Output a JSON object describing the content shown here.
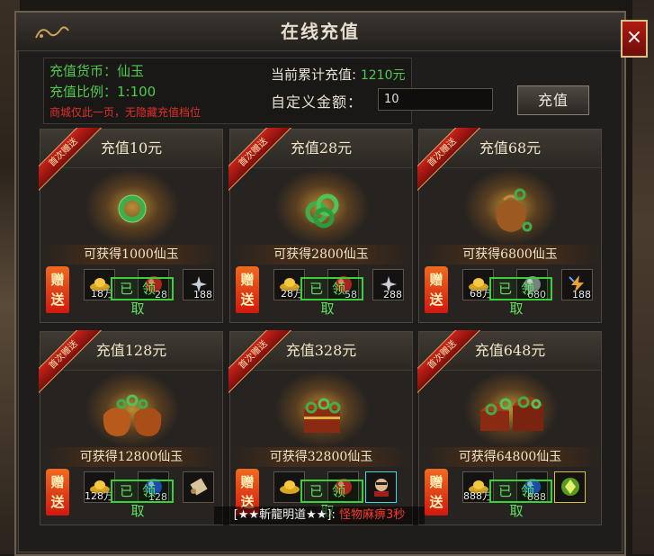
{
  "window": {
    "title": "在线充值",
    "close_label": "×"
  },
  "info": {
    "currency": "充值货币：仙玉",
    "ratio": "充值比例：1:100",
    "warning": "商城仅此一页，无隐藏充值档位"
  },
  "total": {
    "label": "当前累计充值:",
    "value": "1210元"
  },
  "custom_amount": {
    "label": "自定义金额：",
    "value": "10"
  },
  "pay_button": "充值",
  "cards": [
    {
      "ribbon": "首次赠送",
      "title": "充值10元",
      "gain": "可获得1000仙玉",
      "gift": "赠送",
      "slot1": "18万",
      "slot2": "28",
      "slot3": "188",
      "claimed": "已领取",
      "art": "jade-ring"
    },
    {
      "ribbon": "首次赠送",
      "title": "充值28元",
      "gain": "可获得2800仙玉",
      "gift": "赠送",
      "slot1": "28万",
      "slot2": "58",
      "slot3": "288",
      "claimed": "已领取",
      "art": "jade-rings"
    },
    {
      "ribbon": "首次赠送",
      "title": "充值68元",
      "gain": "可获得6800仙玉",
      "gift": "赠送",
      "slot1": "68万",
      "slot2": "680",
      "slot3": "188",
      "claimed": "已领取",
      "art": "jade-bag"
    },
    {
      "ribbon": "首次赠送",
      "title": "充值128元",
      "gain": "可获得12800仙玉",
      "gift": "赠送",
      "slot1": "128万",
      "slot2": "128",
      "slot3": "",
      "claimed": "已领取",
      "art": "jade-bags"
    },
    {
      "ribbon": "首次赠送",
      "title": "充值328元",
      "gain": "可获得32800仙玉",
      "gift": "赠送",
      "slot1": "",
      "slot2": "",
      "slot3": "",
      "claimed": "已领取",
      "art": "treasure-chest"
    },
    {
      "ribbon": "首次赠送",
      "title": "充值648元",
      "gain": "可获得64800仙玉",
      "gift": "赠送",
      "slot1": "888万",
      "slot2": "888",
      "slot3": "",
      "claimed": "已领取",
      "art": "treasure-chests"
    }
  ],
  "notice": {
    "prefix": "[★★斬龍明道★★]:",
    "text": "怪物麻痹3秒"
  },
  "colors": {
    "green": "#4ec94e",
    "red": "#e0302a",
    "gold": "#f1e6c8"
  }
}
